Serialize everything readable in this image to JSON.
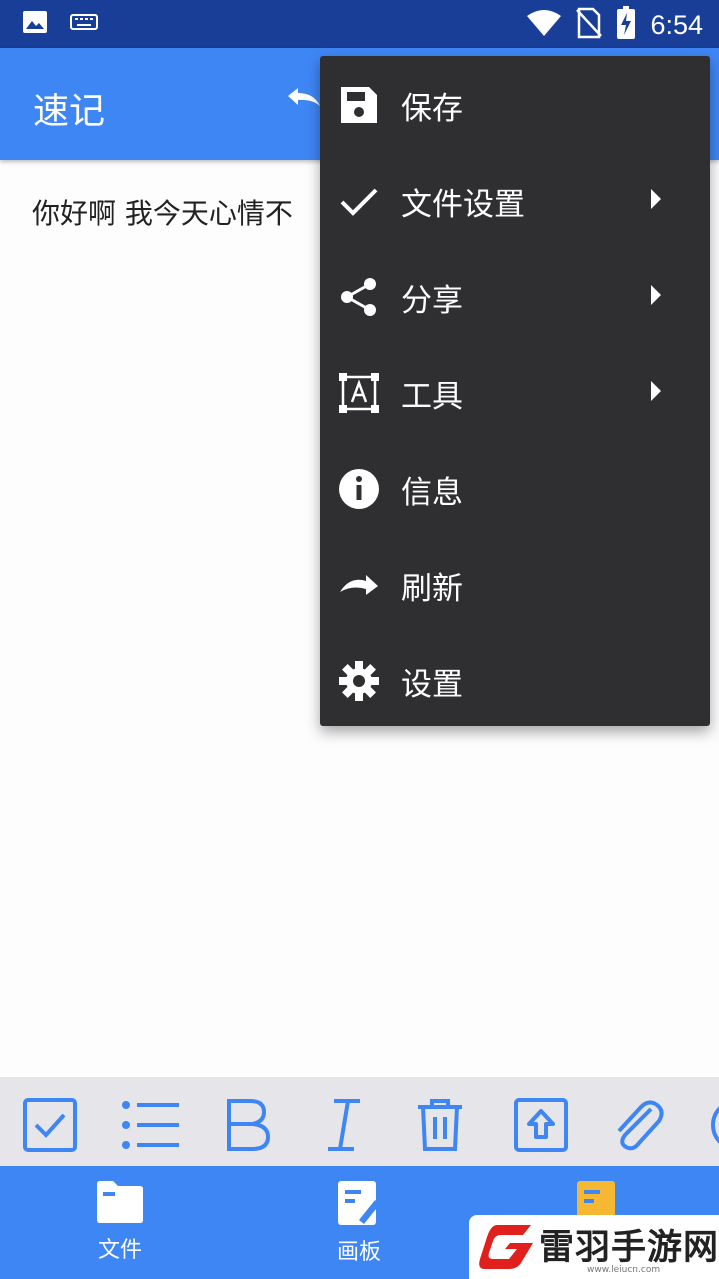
{
  "status_bar": {
    "time": "6:54"
  },
  "app_bar": {
    "title": "速记"
  },
  "editor": {
    "text": "你好啊   我今天心情不"
  },
  "menu": {
    "items": [
      {
        "label": "保存",
        "icon": "save-icon"
      },
      {
        "label": "文件设置",
        "icon": "check-icon",
        "submenu": true
      },
      {
        "label": "分享",
        "icon": "share-icon",
        "submenu": true
      },
      {
        "label": "工具",
        "icon": "text-box-icon",
        "submenu": true
      },
      {
        "label": "信息",
        "icon": "info-icon"
      },
      {
        "label": "刷新",
        "icon": "redo-icon"
      },
      {
        "label": "设置",
        "icon": "gear-icon"
      }
    ]
  },
  "format_toolbar": {
    "icons": [
      "checkbox-icon",
      "list-icon",
      "bold-icon",
      "italic-icon",
      "trash-icon",
      "upload-icon",
      "attachment-icon",
      "more-icon"
    ]
  },
  "bottom_nav": {
    "items": [
      {
        "label": "文件",
        "icon": "folder-icon"
      },
      {
        "label": "画板",
        "icon": "drawing-icon"
      },
      {
        "label": "",
        "icon": "note-icon"
      }
    ]
  },
  "watermark": {
    "text": "雷羽手游网",
    "url": "www.leiucn.com"
  },
  "colors": {
    "primary": "#3f86f5",
    "status_bar": "#183e98",
    "menu_bg": "#2f2f31",
    "toolbar_bg": "#e6e6ea",
    "icon_blue": "#3f86f5"
  }
}
